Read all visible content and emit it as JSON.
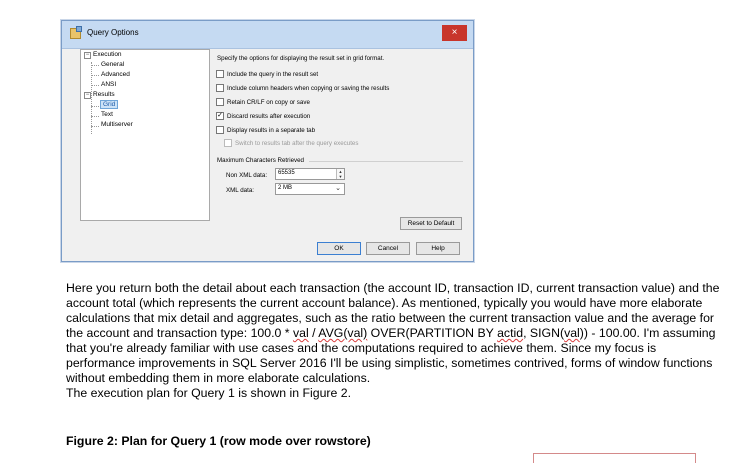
{
  "dialog": {
    "title": "Query Options",
    "close_glyph": "×",
    "tree": {
      "execution": "Execution",
      "general": "General",
      "advanced": "Advanced",
      "ansi": "ANSI",
      "results": "Results",
      "grid": "Grid",
      "text": "Text",
      "multiserver": "Multiserver",
      "toggle_glyph": "−"
    },
    "description": "Specify the options for displaying the result set in grid format.",
    "options": [
      {
        "label": "Include the query in the result set",
        "checked": false
      },
      {
        "label": "Include column headers when copying or saving the results",
        "checked": false
      },
      {
        "label": "Retain CR/LF on copy or save",
        "checked": false
      },
      {
        "label": "Discard results after execution",
        "checked": true
      },
      {
        "label": "Display results in a separate tab",
        "checked": false
      },
      {
        "label": "Switch to results tab after the query executes",
        "checked": false,
        "disabled": true
      }
    ],
    "check_glyph": "✓",
    "max_chars": {
      "heading": "Maximum Characters Retrieved",
      "non_xml_label": "Non XML data:",
      "non_xml_value": "65535",
      "xml_label": "XML data:",
      "xml_value": "2 MB"
    },
    "buttons": {
      "reset": "Reset to Default",
      "ok": "OK",
      "cancel": "Cancel",
      "help": "Help"
    }
  },
  "article": {
    "p1_a": "Here you return both the detail about each transaction (the account ID, transaction ID, current transaction value) and the account total (which represents the current account balance). As mentioned, typically you would have more elaborate calculations that mix detail and aggregates, such as the ratio between the current transaction value and the average for the account and transaction type: 100.0 * ",
    "p1_val": "val",
    "p1_b": " / ",
    "p1_avg": "AVG(val)",
    "p1_c": " OVER(PARTITION BY ",
    "p1_actid": "actid",
    "p1_d": ", SIGN(",
    "p1_val2": "val",
    "p1_e": ")) - 100.00. I'm assuming that you're already familiar with use cases and the computations required to achieve them. Since my focus is performance improvements in SQL Server 2016 I'll be using simplistic, sometimes contrived, forms of window functions without embedding them in more elaborate calculations.",
    "p2": "The execution plan for Query 1 is shown in Figure 2.",
    "figure_caption": "Figure 2: Plan for Query 1 (row mode over rowstore)"
  }
}
